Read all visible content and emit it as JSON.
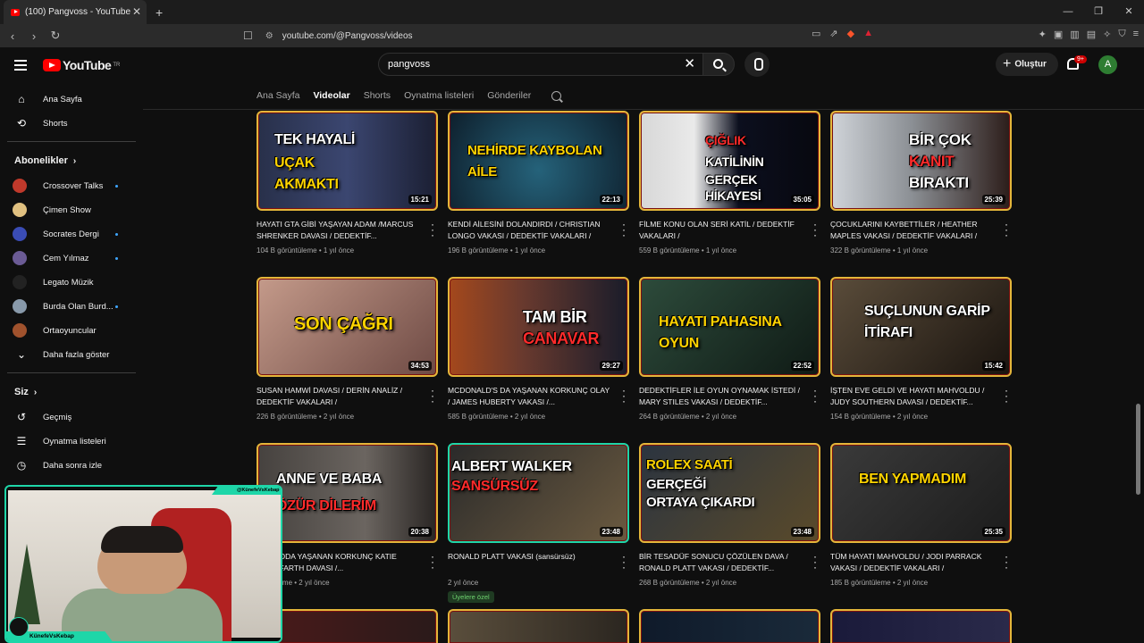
{
  "browser": {
    "tab_title": "(100) Pangvoss - YouTube",
    "url": "youtube.com/@Pangvoss/videos",
    "new_tab": "+",
    "close": "✕"
  },
  "header": {
    "logo_text": "YouTube",
    "logo_region": "TR",
    "search_value": "pangvoss",
    "create_label": "Oluştur",
    "notifications_badge": "9+",
    "avatar_letter": "A"
  },
  "sidebar": {
    "main": [
      {
        "label": "Ana Sayfa",
        "icon": "home-icon"
      },
      {
        "label": "Shorts",
        "icon": "shorts-icon"
      }
    ],
    "subs_heading": "Abonelikler",
    "subscriptions": [
      {
        "label": "Crossover Talks",
        "color": "#c0392b",
        "dot": true
      },
      {
        "label": "Çimen Show",
        "color": "#e0c080",
        "dot": false
      },
      {
        "label": "Socrates Dergi",
        "color": "#3a4cb5",
        "dot": true
      },
      {
        "label": "Cem Yılmaz",
        "color": "#6b5b95",
        "dot": true
      },
      {
        "label": "Legato Müzik",
        "color": "#222222",
        "dot": false
      },
      {
        "label": "Burda Olan Burd...",
        "color": "#8899aa",
        "dot": true
      },
      {
        "label": "Ortaoyuncular",
        "color": "#a0522d",
        "dot": false
      }
    ],
    "show_more": "Daha fazla göster",
    "you_heading": "Siz",
    "you_items": [
      {
        "label": "Geçmiş",
        "icon": "history-icon"
      },
      {
        "label": "Oynatma listeleri",
        "icon": "playlist-icon"
      },
      {
        "label": "Daha sonra izle",
        "icon": "watch-later-icon"
      }
    ]
  },
  "channel_tabs": [
    "Ana Sayfa",
    "Videolar",
    "Shorts",
    "Oynatma listeleri",
    "Gönderiler"
  ],
  "active_tab": "Videolar",
  "videos": [
    {
      "thumb_text": [
        "TEK HAYALİ",
        "UÇAK",
        "AKMAKTI"
      ],
      "duration": "15:21",
      "title": "HAYATI GTA GİBİ YAŞAYAN ADAM /MARCUS SHRENKER DAVASI / DEDEKTİF...",
      "views": "104 B görüntüleme",
      "age": "1 yıl önce"
    },
    {
      "thumb_text": [
        "NEHİRDE KAYBOLAN",
        "AİLE"
      ],
      "duration": "22:13",
      "title": "KENDİ AİLESİNİ DOLANDIRDI / CHRISTIAN LONGO VAKASI / DEDEKTİF VAKALARI /",
      "views": "196 B görüntüleme",
      "age": "1 yıl önce"
    },
    {
      "thumb_text": [
        "ÇIĞLIK",
        "KATİLİNİN",
        "GERÇEK HİKAYESİ"
      ],
      "duration": "35:05",
      "title": "FİLME KONU OLAN SERİ KATİL / DEDEKTİF VAKALARI /",
      "views": "559 B görüntüleme",
      "age": "1 yıl önce"
    },
    {
      "thumb_text": [
        "BİR ÇOK",
        "KANIT",
        "BIRAKTI"
      ],
      "duration": "25:39",
      "title": "ÇOCUKLARINI KAYBETTİLER / HEATHER MAPLES VAKASI / DEDEKTİF VAKALARI /",
      "views": "322 B görüntüleme",
      "age": "1 yıl önce"
    },
    {
      "thumb_text": [
        "SON ÇAĞRI"
      ],
      "duration": "34:53",
      "title": "SUSAN HAMWİ DAVASI / DERİN ANALİZ / DEDEKTİF VAKALARI / @SidarGizemGencer",
      "views": "226 B görüntüleme",
      "age": "2 yıl önce"
    },
    {
      "thumb_text": [
        "TAM BİR",
        "CANAVAR"
      ],
      "duration": "29:27",
      "title": "MCDONALD'S DA YAŞANAN KORKUNÇ OLAY / JAMES HUBERTY VAKASI /...",
      "views": "585 B görüntüleme",
      "age": "2 yıl önce"
    },
    {
      "thumb_text": [
        "HAYATI PAHASINA",
        "OYUN"
      ],
      "duration": "22:52",
      "title": "DEDEKTİFLER İLE OYUN OYNAMAK İSTEDİ / MARY STILES VAKASI / DEDEKTİF...",
      "views": "264 B görüntüleme",
      "age": "2 yıl önce"
    },
    {
      "thumb_text": [
        "SUÇLUNUN GARİP",
        "İTİRAFI"
      ],
      "duration": "15:42",
      "title": "İŞTEN EVE GELDİ VE HAYATI MAHVOLDU / JUDY SOUTHERN DAVASI / DEDEKTİF...",
      "views": "154 B görüntüleme",
      "age": "2 yıl önce"
    },
    {
      "thumb_text": [
        "ANNE VE BABA",
        "ÖZÜR DİLERİM"
      ],
      "duration": "20:38",
      "title": "K DEPODA YAŞANAN KORKUNÇ KATIE WOHLFARTH DAVASI /...",
      "views": "örüntüleme",
      "age": "2 yıl önce"
    },
    {
      "thumb_text": [
        "ALBERT WALKER",
        "SANSÜRSÜZ"
      ],
      "duration": "23:48",
      "title": "RONALD PLATT VAKASI (sansürsüz)",
      "views": "",
      "age": "2 yıl önce",
      "members": "Üyelere özel"
    },
    {
      "thumb_text": [
        "ROLEX SAATİ",
        "GERÇEĞİ",
        "ORTAYA ÇIKARDI"
      ],
      "duration": "23:48",
      "title": "BİR TESADÜF SONUCU ÇÖZÜLEN DAVA / RONALD PLATT VAKASI / DEDEKTİF...",
      "views": "268 B görüntüleme",
      "age": "2 yıl önce"
    },
    {
      "thumb_text": [
        "BEN YAPMADIM"
      ],
      "duration": "25:35",
      "title": "TÜM HAYATI MAHVOLDU / JODI PARRACK VAKASI / DEDEKTİF VAKALARI /",
      "views": "185 B görüntüleme",
      "age": "2 yıl önce"
    }
  ],
  "webcam": {
    "top_label": "@KünefeVsKebap",
    "bottom_label": "KünefeVsKebap"
  },
  "colors": {
    "accent": "#ff0000",
    "webcam_frame": "#1ed6a8",
    "thumb_border": "#e4b63a"
  }
}
